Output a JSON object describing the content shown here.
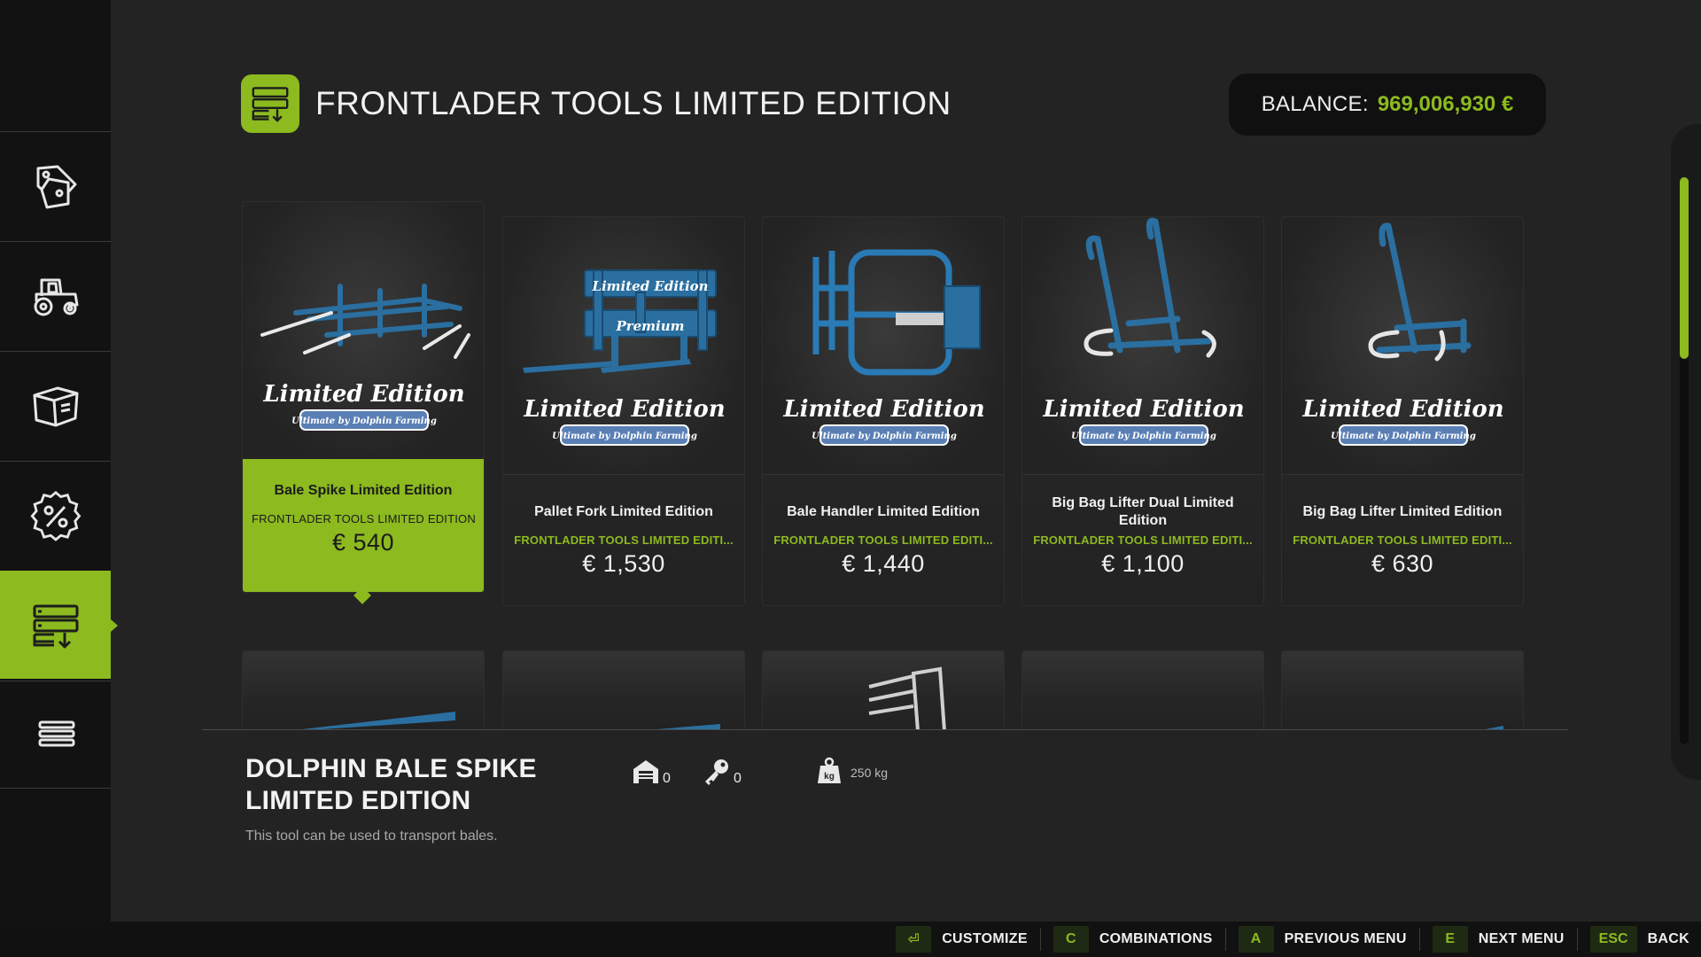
{
  "header": {
    "title": "FRONTLADER TOOLS LIMITED EDITION",
    "category_icon": "frontloader-tools-icon",
    "balance_label": "BALANCE:",
    "balance_value": "969,006,930 €"
  },
  "sidebar": {
    "items": [
      {
        "name": "sales-icon",
        "active": false
      },
      {
        "name": "tractor-icon",
        "active": false
      },
      {
        "name": "box-icon",
        "active": false
      },
      {
        "name": "discount-icon",
        "active": false
      },
      {
        "name": "frontloader-tools-icon",
        "active": true
      },
      {
        "name": "menu-icon",
        "active": false
      }
    ]
  },
  "shop": {
    "items": [
      {
        "name": "Bale Spike Limited Edition",
        "category": "FRONTLADER TOOLS LIMITED EDITION",
        "price": "€ 540",
        "selected": true,
        "logo": "Limited Edition",
        "logo_sub": "Ultimate by Dolphin Farming"
      },
      {
        "name": "Pallet Fork Limited Edition",
        "category": "FRONTLADER TOOLS LIMITED EDITI...",
        "price": "€ 1,530",
        "selected": false,
        "logo": "Limited Edition",
        "logo_sub": "Ultimate by Dolphin Farming",
        "label_top": "Limited Edition",
        "label_mid": "Premium"
      },
      {
        "name": "Bale Handler Limited Edition",
        "category": "FRONTLADER TOOLS LIMITED EDITI...",
        "price": "€ 1,440",
        "selected": false,
        "logo": "Limited Edition",
        "logo_sub": "Ultimate by Dolphin Farming"
      },
      {
        "name": "Big Bag Lifter Dual Limited Edition",
        "category": "FRONTLADER TOOLS LIMITED EDITI...",
        "price": "€ 1,100",
        "selected": false,
        "logo": "Limited Edition",
        "logo_sub": "Ultimate by Dolphin Farming"
      },
      {
        "name": "Big Bag Lifter Limited Edition",
        "category": "FRONTLADER TOOLS LIMITED EDITI...",
        "price": "€ 630",
        "selected": false,
        "logo": "Limited Edition",
        "logo_sub": "Ultimate by Dolphin Farming"
      }
    ]
  },
  "detail": {
    "title_line1": "DOLPHIN BALE SPIKE",
    "title_line2": "LIMITED EDITION",
    "description": "This tool can be used to transport bales.",
    "owned": "0",
    "leased": "0",
    "weight": "250 kg"
  },
  "bottom_bar": {
    "hints": [
      {
        "key": "⏎",
        "label": "CUSTOMIZE"
      },
      {
        "key": "C",
        "label": "COMBINATIONS"
      },
      {
        "key": "A",
        "label": "PREVIOUS MENU"
      },
      {
        "key": "E",
        "label": "NEXT MENU"
      },
      {
        "key": "ESC",
        "label": "BACK"
      }
    ]
  },
  "colors": {
    "accent": "#8cba1f",
    "background": "#232323",
    "sidebar": "#121212",
    "equipment_blue": "#1f5f8f"
  }
}
